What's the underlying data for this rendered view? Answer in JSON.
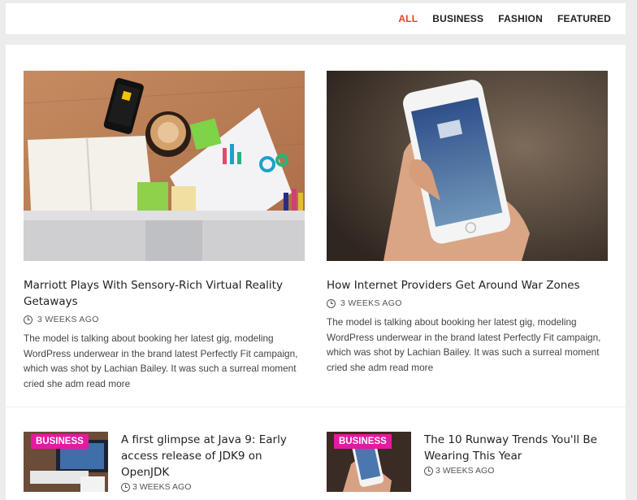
{
  "filters": {
    "tabs": [
      {
        "label": "ALL"
      },
      {
        "label": "BUSINESS"
      },
      {
        "label": "FASHION"
      },
      {
        "label": "FEATURED"
      }
    ],
    "active": "ALL"
  },
  "colors": {
    "accent": "#e8402a",
    "badge": "#e619a2"
  },
  "featured": [
    {
      "image": "desk-with-phone-coffee-notebook",
      "title": "Marriott Plays With Sensory-Rich Virtual Reality Getaways",
      "date": "3 WEEKS AGO",
      "excerpt": "The model is talking about booking her latest gig, modeling WordPress underwear in the brand latest Perfectly Fit campaign, which was shot by Lachian Bailey. It was such a surreal moment cried she adm read more"
    },
    {
      "image": "hand-holding-smartphone",
      "title": "How Internet Providers Get Around War Zones",
      "date": "3 WEEKS AGO",
      "excerpt": "The model is talking about booking her latest gig, modeling WordPress underwear in the brand latest Perfectly Fit campaign, which was shot by Lachian Bailey. It was such a surreal moment cried she adm read more"
    }
  ],
  "small": [
    {
      "category": "BUSINESS",
      "image": "laptop-desk",
      "title": "A first glimpse at Java 9: Early access release of JDK9 on OpenJDK",
      "date": "3 WEEKS AGO"
    },
    {
      "category": "BUSINESS",
      "image": "hand-holding-smartphone",
      "title": "The 10 Runway Trends You'll Be Wearing This Year",
      "date": "3 WEEKS AGO"
    }
  ]
}
